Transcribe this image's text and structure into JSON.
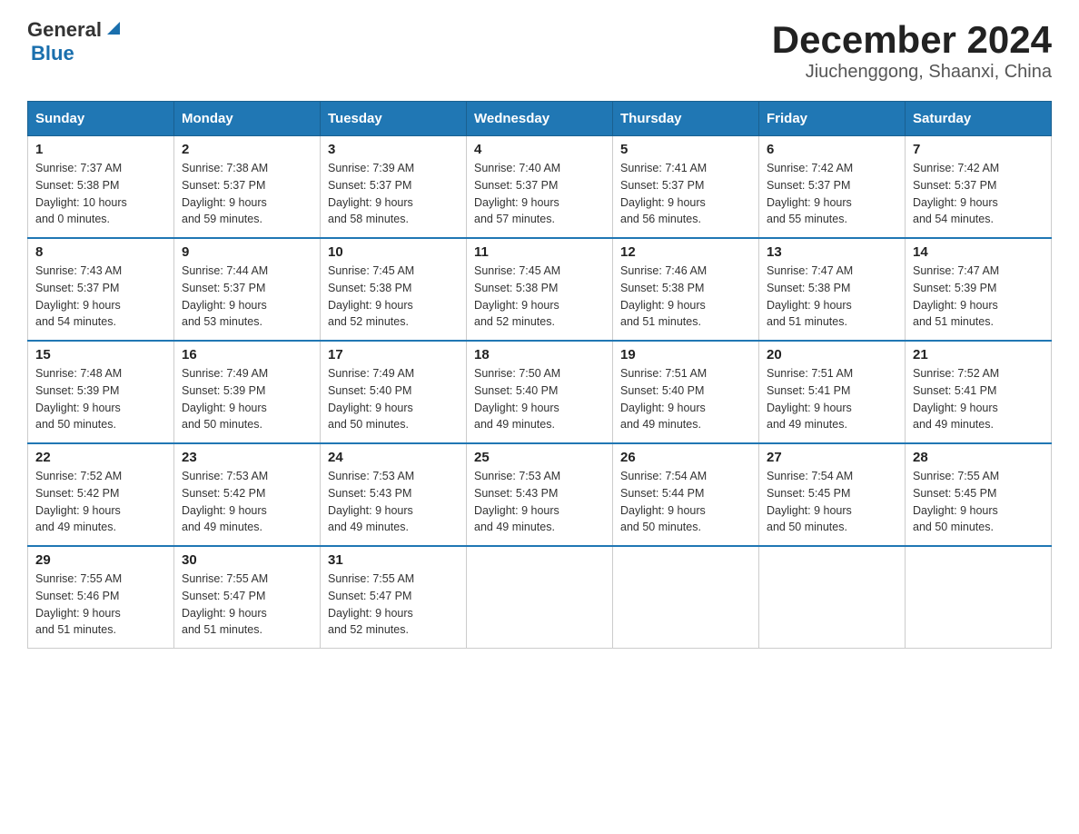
{
  "logo": {
    "text_general": "General",
    "text_blue": "Blue",
    "alt": "GeneralBlue logo"
  },
  "title": {
    "month_year": "December 2024",
    "location": "Jiuchenggong, Shaanxi, China"
  },
  "headers": [
    "Sunday",
    "Monday",
    "Tuesday",
    "Wednesday",
    "Thursday",
    "Friday",
    "Saturday"
  ],
  "weeks": [
    [
      {
        "day": "1",
        "info": "Sunrise: 7:37 AM\nSunset: 5:38 PM\nDaylight: 10 hours\nand 0 minutes."
      },
      {
        "day": "2",
        "info": "Sunrise: 7:38 AM\nSunset: 5:37 PM\nDaylight: 9 hours\nand 59 minutes."
      },
      {
        "day": "3",
        "info": "Sunrise: 7:39 AM\nSunset: 5:37 PM\nDaylight: 9 hours\nand 58 minutes."
      },
      {
        "day": "4",
        "info": "Sunrise: 7:40 AM\nSunset: 5:37 PM\nDaylight: 9 hours\nand 57 minutes."
      },
      {
        "day": "5",
        "info": "Sunrise: 7:41 AM\nSunset: 5:37 PM\nDaylight: 9 hours\nand 56 minutes."
      },
      {
        "day": "6",
        "info": "Sunrise: 7:42 AM\nSunset: 5:37 PM\nDaylight: 9 hours\nand 55 minutes."
      },
      {
        "day": "7",
        "info": "Sunrise: 7:42 AM\nSunset: 5:37 PM\nDaylight: 9 hours\nand 54 minutes."
      }
    ],
    [
      {
        "day": "8",
        "info": "Sunrise: 7:43 AM\nSunset: 5:37 PM\nDaylight: 9 hours\nand 54 minutes."
      },
      {
        "day": "9",
        "info": "Sunrise: 7:44 AM\nSunset: 5:37 PM\nDaylight: 9 hours\nand 53 minutes."
      },
      {
        "day": "10",
        "info": "Sunrise: 7:45 AM\nSunset: 5:38 PM\nDaylight: 9 hours\nand 52 minutes."
      },
      {
        "day": "11",
        "info": "Sunrise: 7:45 AM\nSunset: 5:38 PM\nDaylight: 9 hours\nand 52 minutes."
      },
      {
        "day": "12",
        "info": "Sunrise: 7:46 AM\nSunset: 5:38 PM\nDaylight: 9 hours\nand 51 minutes."
      },
      {
        "day": "13",
        "info": "Sunrise: 7:47 AM\nSunset: 5:38 PM\nDaylight: 9 hours\nand 51 minutes."
      },
      {
        "day": "14",
        "info": "Sunrise: 7:47 AM\nSunset: 5:39 PM\nDaylight: 9 hours\nand 51 minutes."
      }
    ],
    [
      {
        "day": "15",
        "info": "Sunrise: 7:48 AM\nSunset: 5:39 PM\nDaylight: 9 hours\nand 50 minutes."
      },
      {
        "day": "16",
        "info": "Sunrise: 7:49 AM\nSunset: 5:39 PM\nDaylight: 9 hours\nand 50 minutes."
      },
      {
        "day": "17",
        "info": "Sunrise: 7:49 AM\nSunset: 5:40 PM\nDaylight: 9 hours\nand 50 minutes."
      },
      {
        "day": "18",
        "info": "Sunrise: 7:50 AM\nSunset: 5:40 PM\nDaylight: 9 hours\nand 49 minutes."
      },
      {
        "day": "19",
        "info": "Sunrise: 7:51 AM\nSunset: 5:40 PM\nDaylight: 9 hours\nand 49 minutes."
      },
      {
        "day": "20",
        "info": "Sunrise: 7:51 AM\nSunset: 5:41 PM\nDaylight: 9 hours\nand 49 minutes."
      },
      {
        "day": "21",
        "info": "Sunrise: 7:52 AM\nSunset: 5:41 PM\nDaylight: 9 hours\nand 49 minutes."
      }
    ],
    [
      {
        "day": "22",
        "info": "Sunrise: 7:52 AM\nSunset: 5:42 PM\nDaylight: 9 hours\nand 49 minutes."
      },
      {
        "day": "23",
        "info": "Sunrise: 7:53 AM\nSunset: 5:42 PM\nDaylight: 9 hours\nand 49 minutes."
      },
      {
        "day": "24",
        "info": "Sunrise: 7:53 AM\nSunset: 5:43 PM\nDaylight: 9 hours\nand 49 minutes."
      },
      {
        "day": "25",
        "info": "Sunrise: 7:53 AM\nSunset: 5:43 PM\nDaylight: 9 hours\nand 49 minutes."
      },
      {
        "day": "26",
        "info": "Sunrise: 7:54 AM\nSunset: 5:44 PM\nDaylight: 9 hours\nand 50 minutes."
      },
      {
        "day": "27",
        "info": "Sunrise: 7:54 AM\nSunset: 5:45 PM\nDaylight: 9 hours\nand 50 minutes."
      },
      {
        "day": "28",
        "info": "Sunrise: 7:55 AM\nSunset: 5:45 PM\nDaylight: 9 hours\nand 50 minutes."
      }
    ],
    [
      {
        "day": "29",
        "info": "Sunrise: 7:55 AM\nSunset: 5:46 PM\nDaylight: 9 hours\nand 51 minutes."
      },
      {
        "day": "30",
        "info": "Sunrise: 7:55 AM\nSunset: 5:47 PM\nDaylight: 9 hours\nand 51 minutes."
      },
      {
        "day": "31",
        "info": "Sunrise: 7:55 AM\nSunset: 5:47 PM\nDaylight: 9 hours\nand 52 minutes."
      },
      {
        "day": "",
        "info": ""
      },
      {
        "day": "",
        "info": ""
      },
      {
        "day": "",
        "info": ""
      },
      {
        "day": "",
        "info": ""
      }
    ]
  ]
}
